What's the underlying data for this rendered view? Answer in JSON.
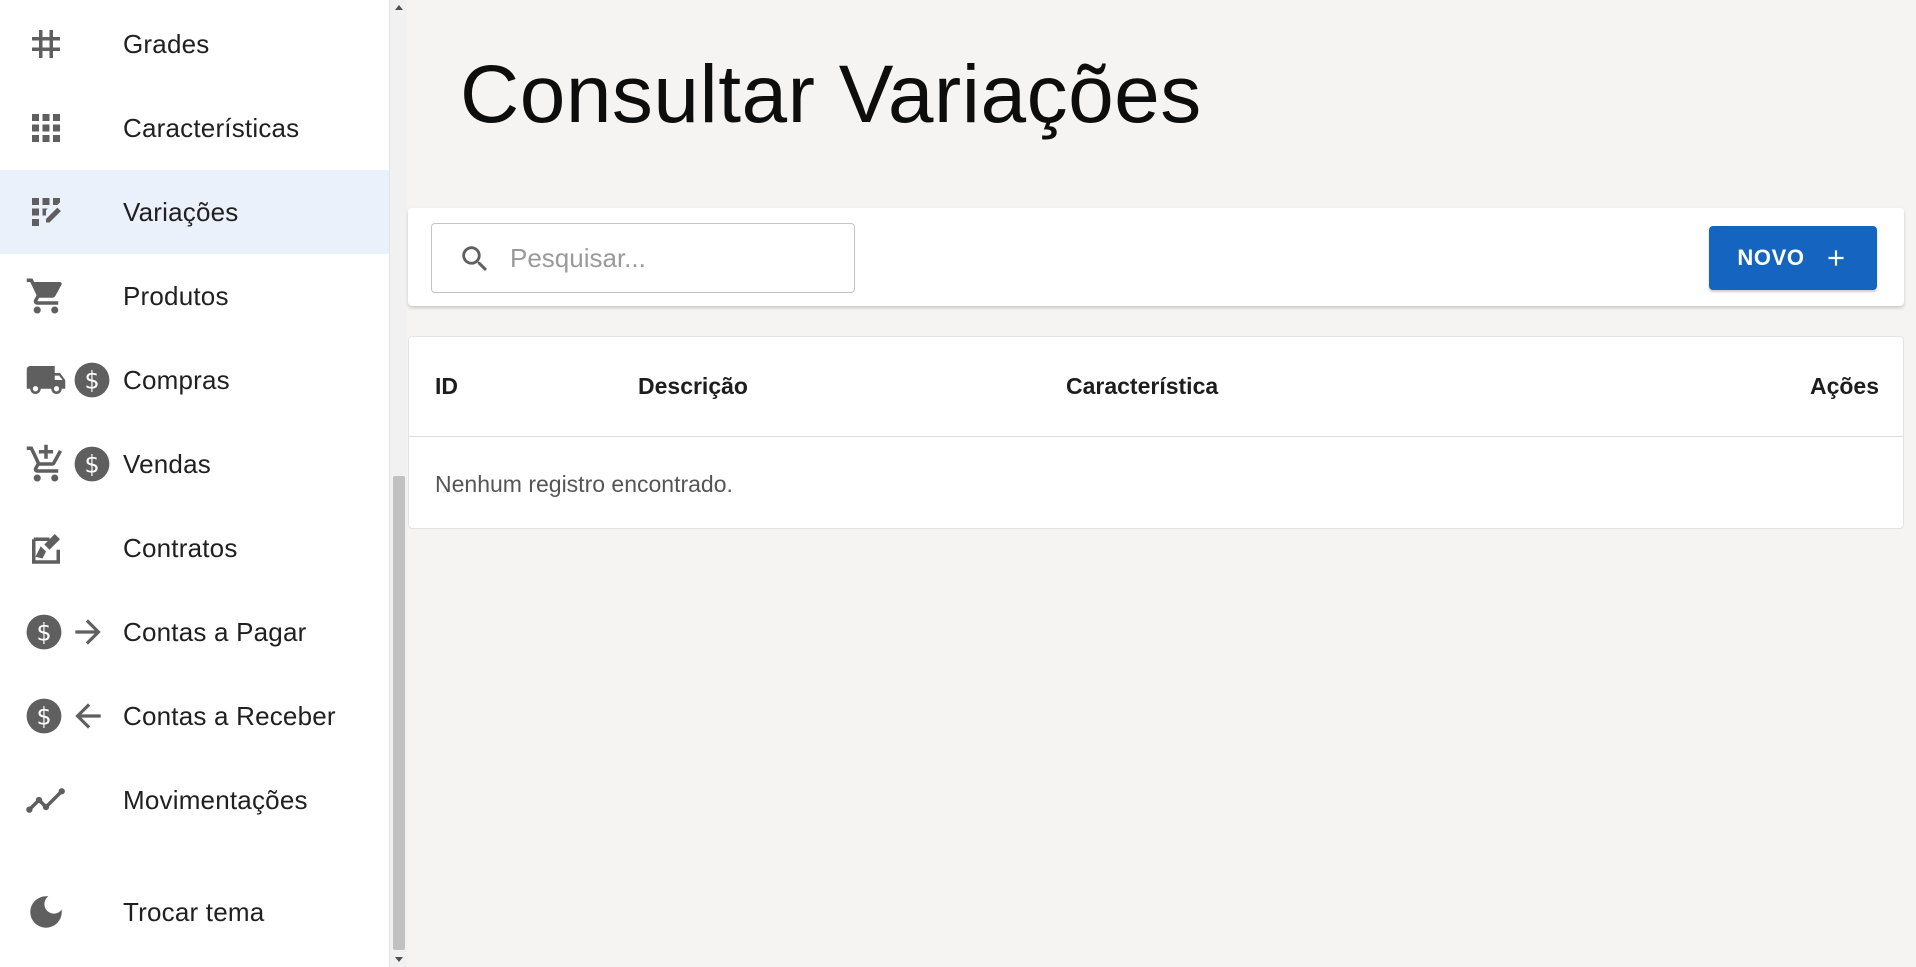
{
  "sidebar": {
    "items": [
      {
        "label": "Grades",
        "icons": [
          "hash-icon"
        ]
      },
      {
        "label": "Características",
        "icons": [
          "grid-icon"
        ]
      },
      {
        "label": "Variações",
        "icons": [
          "grid-edit-icon"
        ],
        "active": true
      },
      {
        "label": "Produtos",
        "icons": [
          "cart-icon"
        ]
      },
      {
        "label": "Compras",
        "icons": [
          "truck-icon",
          "dollar-circle-icon"
        ]
      },
      {
        "label": "Vendas",
        "icons": [
          "cart-plus-icon",
          "dollar-circle-icon"
        ]
      },
      {
        "label": "Contratos",
        "icons": [
          "signature-icon"
        ]
      },
      {
        "label": "Contas a Pagar",
        "icons": [
          "dollar-circle-icon",
          "arrow-right-icon"
        ]
      },
      {
        "label": "Contas a Receber",
        "icons": [
          "dollar-circle-icon",
          "arrow-left-icon"
        ]
      },
      {
        "label": "Movimentações",
        "icons": [
          "trend-line-icon"
        ]
      },
      {
        "label": "Trocar tema",
        "icons": [
          "moon-icon"
        ]
      }
    ]
  },
  "main": {
    "title": "Consultar Variações",
    "search": {
      "placeholder": "Pesquisar...",
      "value": ""
    },
    "new_button": {
      "label": "NOVO"
    },
    "table": {
      "columns": [
        "ID",
        "Descrição",
        "Característica",
        "Ações"
      ],
      "empty_message": "Nenhum registro encontrado."
    }
  },
  "colors": {
    "accent": "#1565c0",
    "active_item_bg": "#eaf1fb",
    "icon": "#5f5f5f",
    "page_bg": "#f5f4f2"
  }
}
